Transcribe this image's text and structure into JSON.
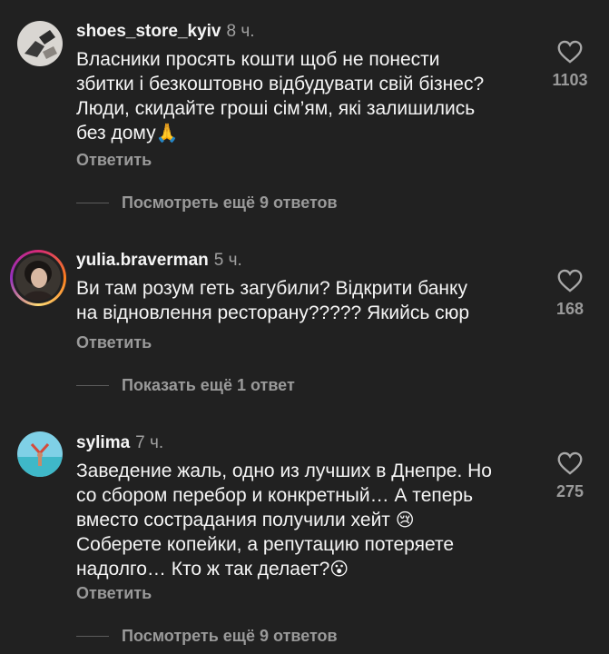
{
  "comments": [
    {
      "username": "shoes_store_kyiv",
      "time": "8 ч.",
      "lines": [
        "Власники просять кошти щоб не понести",
        "збитки і безкоштовно відбудувати свій бізнес?",
        "Люди, скидайте гроші сім’ям, які залишились",
        "без дому"
      ],
      "emoji": "🙏",
      "reply_label": "Ответить",
      "more_label": "Посмотреть ещё 9 ответов",
      "likes": "1103"
    },
    {
      "username": "yulia.braverman",
      "time": "5 ч.",
      "lines": [
        "Ви там розум геть загубили?  Відкрити банку",
        "на відновлення ресторану????? Якийсь сюр"
      ],
      "reply_label": "Ответить",
      "more_label": "Показать ещё 1 ответ",
      "likes": "168"
    },
    {
      "username": "sylima",
      "time": "7 ч.",
      "lines": [
        "Заведение жаль, одно из лучших в Днепре. Но",
        "со сбором перебор и конкретный… А теперь",
        "вместо сострадания получили хейт",
        "Соберете копейки, а репутацию потеряете",
        "надолго…  Кто ж так делает?"
      ],
      "emoji_line3": "😢",
      "emoji_line5": "😮",
      "reply_label": "Ответить",
      "more_label": "Посмотреть ещё 9 ответов",
      "likes": "275"
    }
  ],
  "icons": {
    "like": "heart-outline-icon"
  },
  "colors": {
    "background": "#212121",
    "text": "#f5f5f5",
    "muted": "#9a9a9a"
  }
}
